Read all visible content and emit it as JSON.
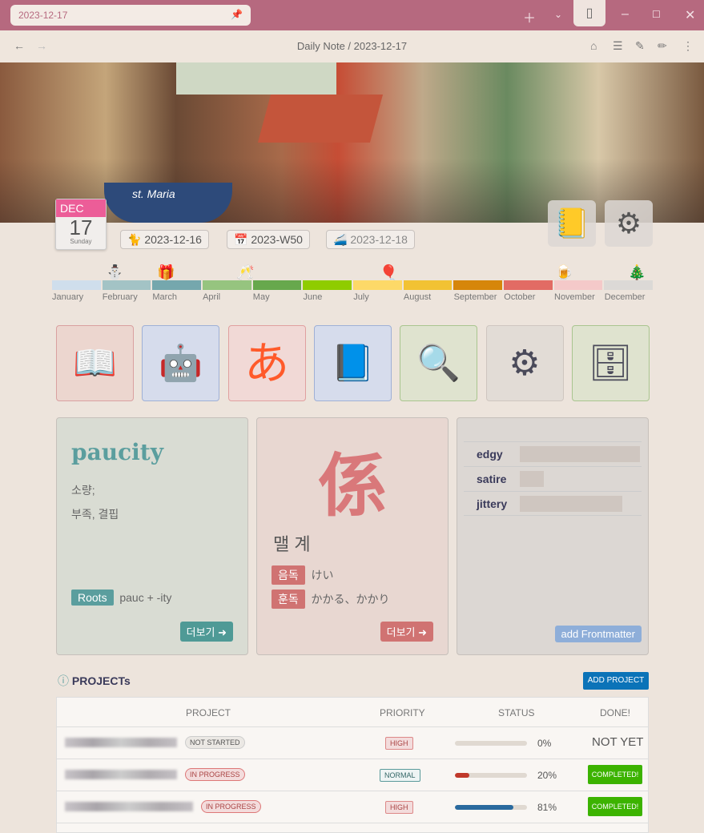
{
  "window": {
    "tab_title": "2023-12-17"
  },
  "nav": {
    "breadcrumb": "Daily Note / 2023-12-17"
  },
  "banner": {
    "boat_name": "st. Maria"
  },
  "calendar": {
    "month": "DEC",
    "day": "17",
    "weekday": "Sunday"
  },
  "date_nav": {
    "prev": "2023-12-16",
    "week": "2023-W50",
    "next": "2023-12-18"
  },
  "months": {
    "labels": [
      "January",
      "February",
      "March",
      "April",
      "May",
      "June",
      "July",
      "August",
      "September",
      "October",
      "November",
      "December"
    ],
    "colors": [
      "#cfdeec",
      "#a3c3c5",
      "#75a7ad",
      "#96c47f",
      "#67a84d",
      "#8fcc00",
      "#fdd968",
      "#f2c233",
      "#d6860a",
      "#e26b64",
      "#f4c9c9",
      "#dcd9d6"
    ]
  },
  "shortcuts": [
    {
      "name": "dictionary",
      "glyph": "📖"
    },
    {
      "name": "ai-chat",
      "glyph": "🤖"
    },
    {
      "name": "hiragana",
      "glyph": "あ"
    },
    {
      "name": "english-book",
      "glyph": "📘"
    },
    {
      "name": "wiki-search",
      "glyph": "🔍"
    },
    {
      "name": "workflow",
      "glyph": "⚙"
    },
    {
      "name": "drawer",
      "glyph": "🗄"
    }
  ],
  "vocab": {
    "word": "paucity",
    "meanings": [
      "소량;",
      "부족, 결핍"
    ],
    "roots_label": "Roots",
    "roots": "pauc + -ity",
    "more": "더보기 ➜"
  },
  "kanji": {
    "char": "係",
    "reading_kr": "맬 계",
    "on_label": "음독",
    "on": "けい",
    "kun_label": "훈독",
    "kun": "かかる、かかり",
    "more": "더보기 ➜"
  },
  "frontmatter": {
    "items": [
      "edgy",
      "satire",
      "jittery"
    ],
    "add": "add Frontmatter"
  },
  "projects": {
    "title": "PROJECTs",
    "add": "ADD PROJECT",
    "headers": [
      "PROJECT",
      "PRIORITY",
      "STATUS",
      "DONE!"
    ],
    "rows": [
      {
        "status": "NOT STARTED",
        "priority": "HIGH",
        "progress": 0,
        "pct": "0%",
        "done": "NOT YET"
      },
      {
        "status": "IN PROGRESS",
        "priority": "NORMAL",
        "progress": 20,
        "pct": "20%",
        "done": "COMPLETED!"
      },
      {
        "status": "IN PROGRESS",
        "priority": "HIGH",
        "progress": 81,
        "pct": "81%",
        "done": "COMPLETED!"
      }
    ]
  }
}
